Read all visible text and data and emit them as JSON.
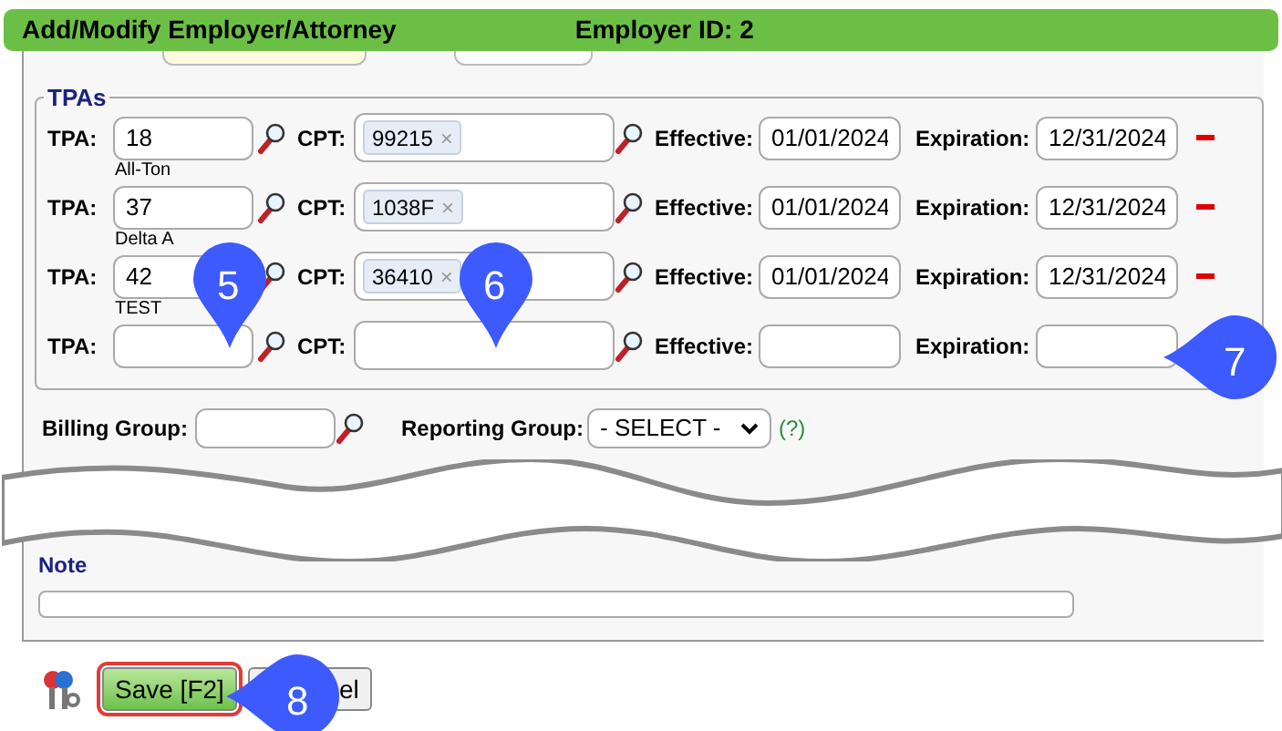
{
  "header": {
    "title": "Add/Modify Employer/Attorney",
    "id_label": "Employer ID: 2"
  },
  "tpas": {
    "legend": "TPAs",
    "rows": [
      {
        "tpa_label": "TPA:",
        "tpa": "18",
        "tpa_name": "All-Ton",
        "cpt_label": "CPT:",
        "cpt_tags": [
          {
            "code": "99215",
            "remove": "×"
          }
        ],
        "effective_label": "Effective:",
        "effective": "01/01/2024",
        "expiration_label": "Expiration:",
        "expiration": "12/31/2024",
        "removable": true
      },
      {
        "tpa_label": "TPA:",
        "tpa": "37",
        "tpa_name": "Delta A",
        "cpt_label": "CPT:",
        "cpt_tags": [
          {
            "code": "1038F",
            "remove": "×"
          }
        ],
        "effective_label": "Effective:",
        "effective": "01/01/2024",
        "expiration_label": "Expiration:",
        "expiration": "12/31/2024",
        "removable": true
      },
      {
        "tpa_label": "TPA:",
        "tpa": "42",
        "tpa_name": "TEST",
        "cpt_label": "CPT:",
        "cpt_tags": [
          {
            "code": "36410",
            "remove": "×"
          }
        ],
        "effective_label": "Effective:",
        "effective": "01/01/2024",
        "expiration_label": "Expiration:",
        "expiration": "12/31/2024",
        "removable": true
      },
      {
        "tpa_label": "TPA:",
        "tpa": "",
        "cpt_label": "CPT:",
        "cpt_tags": [],
        "effective_label": "Effective:",
        "effective": "",
        "expiration_label": "Expiration:",
        "expiration": ""
      }
    ]
  },
  "billing": {
    "billing_label": "Billing Group:",
    "reporting_label": "Reporting Group:",
    "reporting_value": "- SELECT -",
    "help": "(?)"
  },
  "note": {
    "label": "Note"
  },
  "buttons": [
    {
      "label": "Save [F2]",
      "highlighted": true
    },
    {
      "label": "el",
      "highlighted": false
    }
  ],
  "markers": [
    {
      "number": "5",
      "kind": "down"
    },
    {
      "number": "6",
      "kind": "down"
    },
    {
      "number": "7",
      "kind": "left"
    },
    {
      "number": "8",
      "kind": "left"
    }
  ]
}
